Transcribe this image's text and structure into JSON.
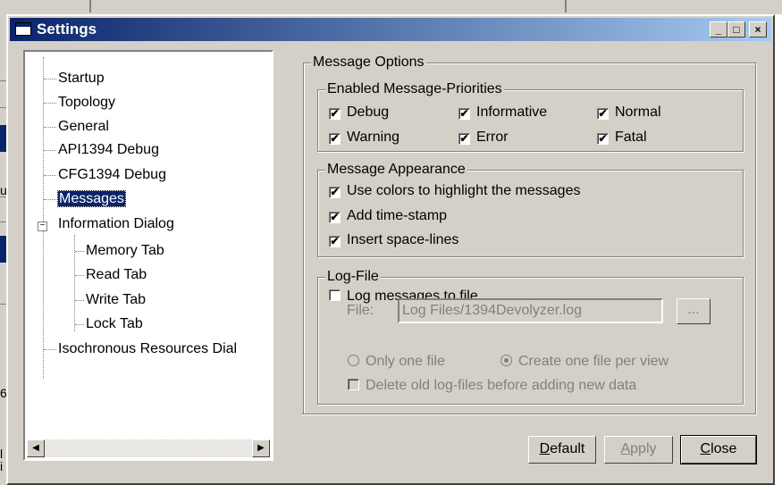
{
  "window": {
    "title": "Settings",
    "minimize": "_",
    "maximize": "□",
    "close": "×"
  },
  "tree": {
    "items": [
      {
        "label": "Startup",
        "level": 0
      },
      {
        "label": "Topology",
        "level": 0
      },
      {
        "label": "General",
        "level": 0
      },
      {
        "label": "API1394 Debug",
        "level": 0
      },
      {
        "label": "CFG1394 Debug",
        "level": 0
      },
      {
        "label": "Messages",
        "level": 0,
        "selected": true
      },
      {
        "label": "Information Dialog",
        "level": 0,
        "expanded": true
      },
      {
        "label": "Memory Tab",
        "level": 1
      },
      {
        "label": "Read Tab",
        "level": 1
      },
      {
        "label": "Write Tab",
        "level": 1
      },
      {
        "label": "Lock Tab",
        "level": 1
      },
      {
        "label": "Isochronous Resources Dial",
        "level": 0
      }
    ],
    "scroll_left": "◀",
    "scroll_right": "▶"
  },
  "message_options": {
    "title": "Message Options",
    "priorities": {
      "title": "Enabled Message-Priorities",
      "items": [
        {
          "label": "Debug",
          "checked": true
        },
        {
          "label": "Informative",
          "checked": true
        },
        {
          "label": "Normal",
          "checked": true
        },
        {
          "label": "Warning",
          "checked": true
        },
        {
          "label": "Error",
          "checked": true
        },
        {
          "label": "Fatal",
          "checked": true
        }
      ]
    },
    "appearance": {
      "title": "Message Appearance",
      "items": [
        {
          "label": "Use colors to highlight the messages",
          "checked": true
        },
        {
          "label": "Add time-stamp",
          "checked": true
        },
        {
          "label": "Insert space-lines",
          "checked": true
        }
      ]
    },
    "logfile": {
      "title": "Log-File",
      "log_to_file": {
        "label": "Log messages to file",
        "checked": false
      },
      "file_label": "File:",
      "file_value": "Log Files/1394Devolyzer.log",
      "browse": "...",
      "radio_one": {
        "label": "Only one file",
        "selected": false
      },
      "radio_per_view": {
        "label": "Create one file per view",
        "selected": true
      },
      "delete_old": {
        "label": "Delete old log-files before adding new data",
        "checked": false
      }
    }
  },
  "buttons": {
    "default_pre": "D",
    "default_rest": "efault",
    "apply_pre": "A",
    "apply_rest": "pply",
    "close_pre": "C",
    "close_rest": "lose"
  },
  "checkmark": "✔",
  "background": {
    "left_chars": [
      "u",
      "6",
      "l",
      "i"
    ]
  }
}
